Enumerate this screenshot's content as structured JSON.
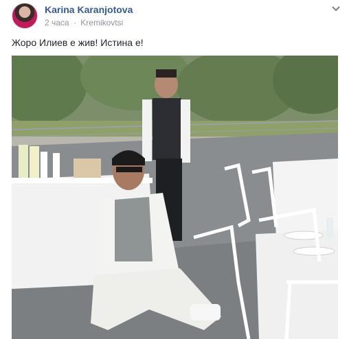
{
  "post": {
    "author": "Karina Karanjotova",
    "time": "2 часа",
    "location": "Kremikovtsi",
    "separator": "·",
    "text": "Жоро Илиев е жив! Истина е!"
  },
  "icons": {
    "options": "chevron-down-icon",
    "avatar": "avatar"
  },
  "colors": {
    "author_link": "#365899",
    "meta": "#90949c",
    "body_text": "#1d2129"
  }
}
